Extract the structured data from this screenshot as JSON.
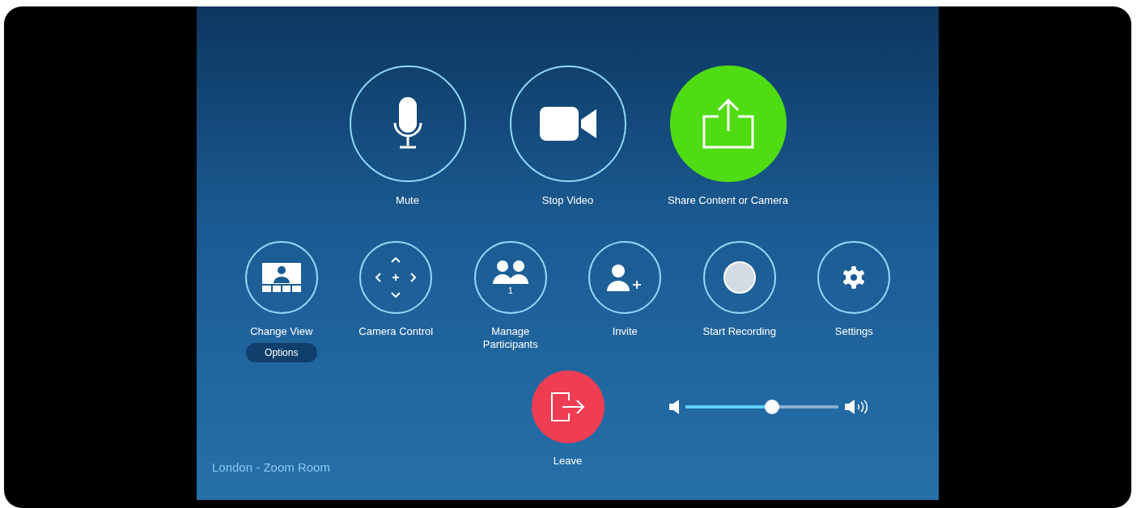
{
  "main_buttons": [
    {
      "kind": "mic",
      "label": "Mute"
    },
    {
      "kind": "video",
      "label": "Stop Video"
    },
    {
      "kind": "share",
      "label": "Share Content or Camera"
    }
  ],
  "controls": [
    {
      "kind": "view",
      "label": "Change View",
      "option": "Options"
    },
    {
      "kind": "camera",
      "label": "Camera Control"
    },
    {
      "kind": "participants",
      "label": "Manage Participants",
      "count": "1"
    },
    {
      "kind": "invite",
      "label": "Invite"
    },
    {
      "kind": "record",
      "label": "Start Recording"
    },
    {
      "kind": "settings",
      "label": "Settings"
    }
  ],
  "leave_button": {
    "label": "Leave"
  },
  "volume": {
    "level": 0.57
  },
  "room_name": "London - Zoom Room"
}
